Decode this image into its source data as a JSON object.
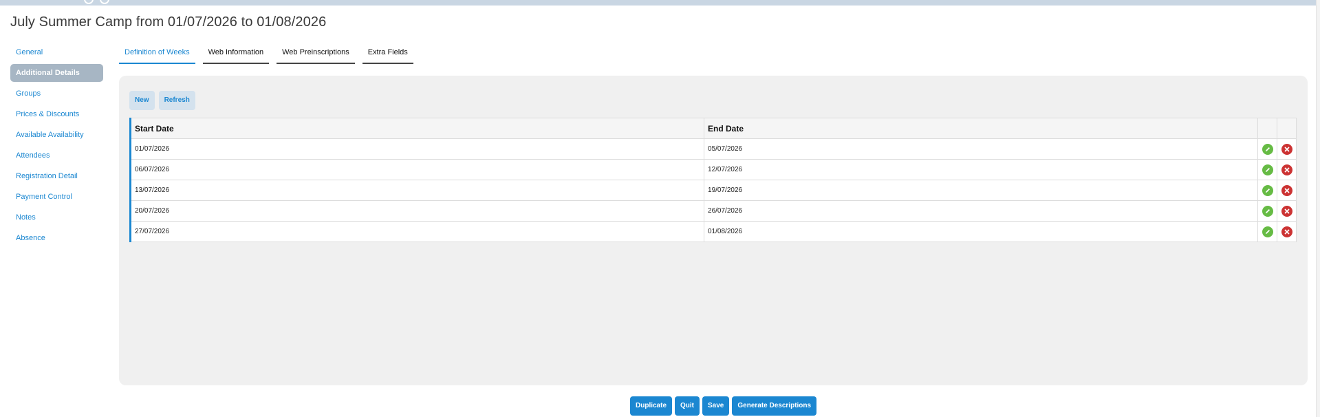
{
  "page": {
    "title": "July Summer Camp from 01/07/2026 to 01/08/2026"
  },
  "sidebar": {
    "items": [
      {
        "label": "General"
      },
      {
        "label": "Additional Details"
      },
      {
        "label": "Groups"
      },
      {
        "label": "Prices & Discounts"
      },
      {
        "label": "Available Availability"
      },
      {
        "label": "Attendees"
      },
      {
        "label": "Registration Detail"
      },
      {
        "label": "Payment Control"
      },
      {
        "label": "Notes"
      },
      {
        "label": "Absence"
      }
    ]
  },
  "tabs": [
    {
      "label": "Definition of Weeks"
    },
    {
      "label": "Web Information"
    },
    {
      "label": "Web Preinscriptions"
    },
    {
      "label": "Extra Fields"
    }
  ],
  "toolbar": {
    "new_label": "New",
    "refresh_label": "Refresh"
  },
  "table": {
    "headers": [
      "Start Date",
      "End Date"
    ],
    "rows": [
      {
        "start": "01/07/2026",
        "end": "05/07/2026"
      },
      {
        "start": "06/07/2026",
        "end": "12/07/2026"
      },
      {
        "start": "13/07/2026",
        "end": "19/07/2026"
      },
      {
        "start": "20/07/2026",
        "end": "26/07/2026"
      },
      {
        "start": "27/07/2026",
        "end": "01/08/2026"
      }
    ]
  },
  "actions": {
    "duplicate": "Duplicate",
    "quit": "Quit",
    "save": "Save",
    "generate": "Generate Descriptions"
  },
  "icons": {
    "edit": "pencil-icon",
    "delete": "close-icon"
  },
  "colors": {
    "accent": "#1b87d1",
    "edit": "#66bb44",
    "delete": "#cc3333",
    "active_side": "#a7b6c4"
  }
}
